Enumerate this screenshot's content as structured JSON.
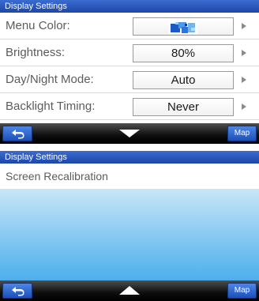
{
  "screen1": {
    "title": "Display Settings",
    "rows": [
      {
        "label": "Menu Color:",
        "value": "",
        "value_type": "color-swatch",
        "arrow": "right-arrow-icon"
      },
      {
        "label": "Brightness:",
        "value": "80%",
        "arrow": "right-arrow-icon"
      },
      {
        "label": "Day/Night Mode:",
        "value": "Auto",
        "arrow": "right-arrow-icon"
      },
      {
        "label": "Backlight Timing:",
        "value": "Never",
        "arrow": "right-arrow-icon"
      }
    ],
    "nav": {
      "back_icon": "back-arrow-icon",
      "center_icon": "scroll-down-arrow-icon",
      "map_label": "Map"
    }
  },
  "screen2": {
    "title": "Display Settings",
    "item": "Screen Recalibration",
    "nav": {
      "back_icon": "back-arrow-icon",
      "center_icon": "scroll-up-arrow-icon",
      "map_label": "Map"
    }
  },
  "colors": {
    "title_bar": "#2a56bb",
    "button_blue": "#2f62cc",
    "nav_black": "#000000",
    "gradient_top": "#c9e6f7",
    "gradient_bottom": "#3aa2e6"
  }
}
